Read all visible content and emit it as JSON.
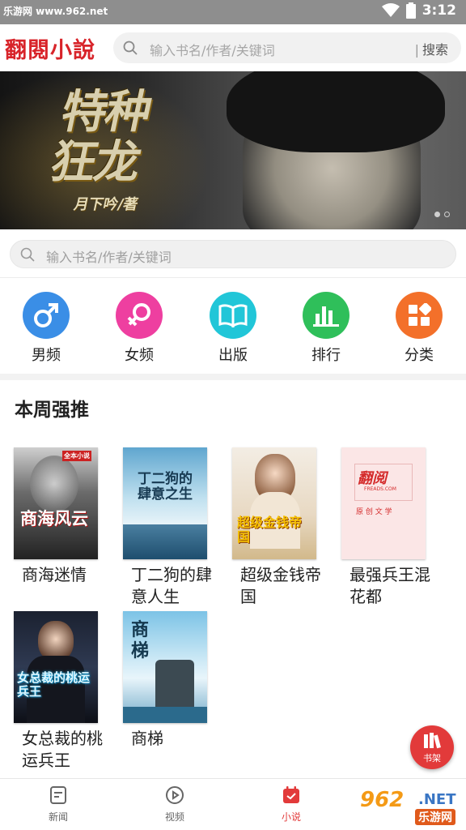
{
  "status_bar": {
    "watermark": "乐游网 www.962.net",
    "time": "3:12"
  },
  "header": {
    "logo": "翻閱小說",
    "search_placeholder": "输入书名/作者/关键词",
    "search_button": "搜索"
  },
  "banner": {
    "title_line1": "特种",
    "title_line2": "狂龙",
    "author": "月下吟/著",
    "slide_count": 2,
    "active_slide": 1
  },
  "search2": {
    "placeholder": "输入书名/作者/关键词"
  },
  "categories": [
    {
      "label": "男频",
      "icon": "male-icon",
      "color": "#3a8ee6"
    },
    {
      "label": "女频",
      "icon": "female-icon",
      "color": "#ee3fa0"
    },
    {
      "label": "出版",
      "icon": "book-open-icon",
      "color": "#21c6d8"
    },
    {
      "label": "排行",
      "icon": "bar-chart-icon",
      "color": "#2fbf5a"
    },
    {
      "label": "分类",
      "icon": "grid-icon",
      "color": "#f3702a"
    }
  ],
  "section": {
    "title": "本周强推"
  },
  "books": [
    {
      "title": "商海迷情",
      "cover_text": "商海风云",
      "cover_sub": "全本小说"
    },
    {
      "title": "丁二狗的肆意人生",
      "cover_text": "丁二狗的肆意之生",
      "cover_sub": ""
    },
    {
      "title": "超级金钱帝国",
      "cover_text": "超级金钱帝国",
      "cover_sub": ""
    },
    {
      "title": "最强兵王混花都",
      "cover_text": "翻阅",
      "cover_sub": "FREADS.COM",
      "cover_row": "原 创 文 学"
    },
    {
      "title": "女总裁的桃运兵王",
      "cover_text": "女总裁的桃运兵王",
      "cover_sub": ""
    },
    {
      "title": "商梯",
      "cover_text": "商梯",
      "cover_sub": ""
    }
  ],
  "floating": {
    "label": "书架"
  },
  "bottom_nav": [
    {
      "label": "新闻",
      "icon": "news-icon"
    },
    {
      "label": "视频",
      "icon": "play-icon"
    },
    {
      "label": "小说",
      "icon": "novel-icon",
      "active": true
    }
  ],
  "watermark": {
    "big": "962",
    "net": ".NET",
    "sub": "乐游网"
  }
}
